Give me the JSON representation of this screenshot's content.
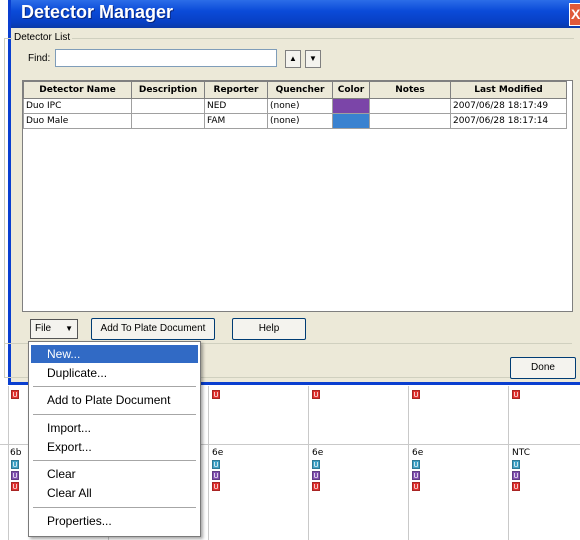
{
  "window": {
    "title": "Detector Manager",
    "close_label": "X"
  },
  "detector_list": {
    "legend": "Detector List",
    "find_label": "Find:",
    "find_value": "",
    "up_arrow": "▲",
    "down_arrow": "▼",
    "columns": [
      "Detector Name",
      "Description",
      "Reporter",
      "Quencher",
      "Color",
      "Notes",
      "Last Modified"
    ],
    "rows": [
      {
        "name": "Duo IPC",
        "description": "",
        "reporter": "NED",
        "quencher": "(none)",
        "color": "#7b45a8",
        "notes": "",
        "modified": "2007/06/28 18:17:49"
      },
      {
        "name": "Duo Male",
        "description": "",
        "reporter": "FAM",
        "quencher": "(none)",
        "color": "#3a82d0",
        "notes": "",
        "modified": "2007/06/28 18:17:14"
      }
    ]
  },
  "buttons": {
    "file": "File",
    "add_to_plate": "Add To Plate Document",
    "help": "Help",
    "done": "Done"
  },
  "file_menu": {
    "items": [
      "New...",
      "Duplicate...",
      "Add to Plate Document",
      "Import...",
      "Export...",
      "Clear",
      "Clear All",
      "Properties..."
    ],
    "selected": "New..."
  },
  "plate": {
    "row_labels": [
      "6b",
      "6e",
      "6e",
      "6e",
      "NTC"
    ],
    "u_marker": "U"
  },
  "colors": {
    "title_bar": "#0a4ad8",
    "selection": "#316ac5",
    "marker_red": "#e0312f",
    "marker_cyan": "#3fa2c6",
    "marker_purple": "#8050b0"
  }
}
